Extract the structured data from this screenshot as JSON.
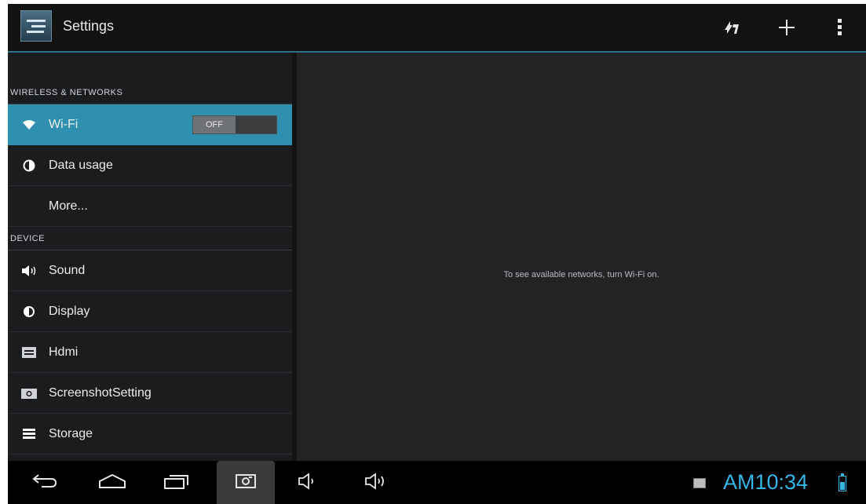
{
  "action_bar": {
    "title": "Settings",
    "icons": [
      "settings-app-icon",
      "sync-icon",
      "add-icon",
      "overflow-menu-icon"
    ]
  },
  "sidebar": {
    "wireless_header": "WIRELESS & NETWORKS",
    "device_header": "DEVICE",
    "wifi": {
      "label": "Wi-Fi",
      "toggle_label": "OFF"
    },
    "items": [
      {
        "label": "Data usage",
        "icon": "data-usage-icon"
      },
      {
        "label": "More..."
      },
      {
        "label": "Sound",
        "icon": "speaker-icon"
      },
      {
        "label": "Display",
        "icon": "brightness-icon"
      },
      {
        "label": "Hdmi",
        "icon": "hdmi-icon"
      },
      {
        "label": "ScreenshotSetting",
        "icon": "camera-icon"
      },
      {
        "label": "Storage",
        "icon": "storage-icon"
      }
    ]
  },
  "main": {
    "message": "To see available networks, turn Wi-Fi on."
  },
  "navbar": {
    "time": "AM10:34",
    "icons": [
      "back-icon",
      "home-icon",
      "recent-apps-icon",
      "screenshot-icon",
      "volume-down-icon",
      "volume-up-icon",
      "gallery-notification-icon",
      "battery-icon"
    ]
  },
  "colors": {
    "accent": "#2e8fae",
    "clock": "#34b5e5",
    "background": "#0a0a0a"
  }
}
